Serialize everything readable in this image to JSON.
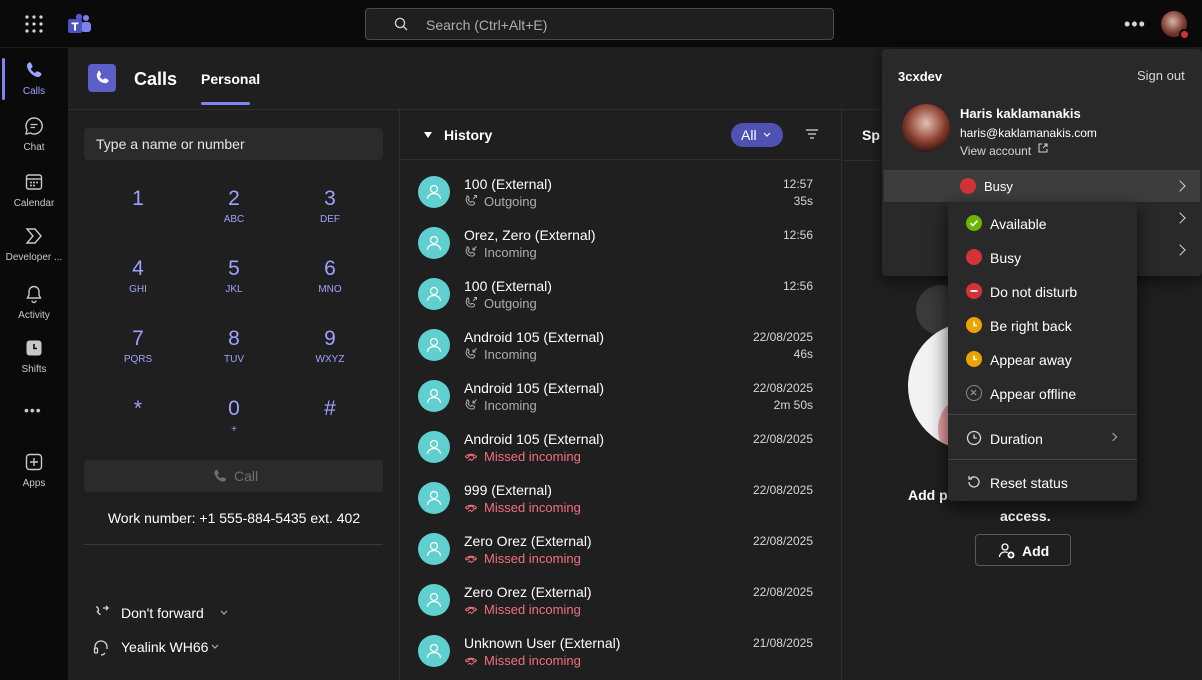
{
  "search": {
    "placeholder": "Search (Ctrl+Alt+E)"
  },
  "rail": [
    {
      "label": "Calls"
    },
    {
      "label": "Chat"
    },
    {
      "label": "Calendar"
    },
    {
      "label": "Developer ..."
    },
    {
      "label": "Activity"
    },
    {
      "label": "Shifts"
    },
    {
      "label": "Apps"
    }
  ],
  "header": {
    "title": "Calls",
    "tab": "Personal"
  },
  "dialpad": {
    "placeholder": "Type a name or number",
    "keys": [
      {
        "d": "1",
        "s": ""
      },
      {
        "d": "2",
        "s": "ABC"
      },
      {
        "d": "3",
        "s": "DEF"
      },
      {
        "d": "4",
        "s": "GHI"
      },
      {
        "d": "5",
        "s": "JKL"
      },
      {
        "d": "6",
        "s": "MNO"
      },
      {
        "d": "7",
        "s": "PQRS"
      },
      {
        "d": "8",
        "s": "TUV"
      },
      {
        "d": "9",
        "s": "WXYZ"
      },
      {
        "d": "*",
        "s": ""
      },
      {
        "d": "0",
        "s": "+"
      },
      {
        "d": "#",
        "s": ""
      }
    ],
    "call_label": "Call",
    "work_number": "Work number: +1 555-884-5435 ext. 402",
    "forward_label": "Don't forward",
    "device_label": "Yealink WH66"
  },
  "history": {
    "title": "History",
    "filter_label": "All",
    "rows": [
      {
        "name": "100 (External)",
        "type": "Outgoing",
        "time": "12:57",
        "duration": "35s"
      },
      {
        "name": "Orez, Zero (External)",
        "type": "Incoming",
        "time": "12:56",
        "duration": ""
      },
      {
        "name": "100 (External)",
        "type": "Outgoing",
        "time": "12:56",
        "duration": ""
      },
      {
        "name": "Android 105 (External)",
        "type": "Incoming",
        "time": "22/08/2025",
        "duration": "46s"
      },
      {
        "name": "Android 105 (External)",
        "type": "Incoming",
        "time": "22/08/2025",
        "duration": "2m 50s"
      },
      {
        "name": "Android 105 (External)",
        "type": "Missed incoming",
        "time": "22/08/2025",
        "duration": ""
      },
      {
        "name": "999 (External)",
        "type": "Missed incoming",
        "time": "22/08/2025",
        "duration": ""
      },
      {
        "name": "Zero Orez (External)",
        "type": "Missed incoming",
        "time": "22/08/2025",
        "duration": ""
      },
      {
        "name": "Zero Orez (External)",
        "type": "Missed incoming",
        "time": "22/08/2025",
        "duration": ""
      },
      {
        "name": "Unknown User (External)",
        "type": "Missed incoming",
        "time": "21/08/2025",
        "duration": ""
      }
    ]
  },
  "speed_dial": {
    "heading": "Sp",
    "add_text": "Add p",
    "access_text": "access.",
    "add_button": "Add"
  },
  "account": {
    "tenant": "3cxdev",
    "sign_out": "Sign out",
    "name": "Haris kaklamanakis",
    "email": "haris@kaklamanakis.com",
    "view_account": "View account",
    "status": "Busy"
  },
  "status_menu": {
    "items": [
      {
        "label": "Available",
        "color": "#6bb700"
      },
      {
        "label": "Busy",
        "color": "#d13438"
      },
      {
        "label": "Do not disturb",
        "color": "#d13438"
      },
      {
        "label": "Be right back",
        "color": "#eaa300"
      },
      {
        "label": "Appear away",
        "color": "#eaa300"
      },
      {
        "label": "Appear offline",
        "color": "#8a8a8a"
      }
    ],
    "duration": "Duration",
    "reset": "Reset status"
  }
}
